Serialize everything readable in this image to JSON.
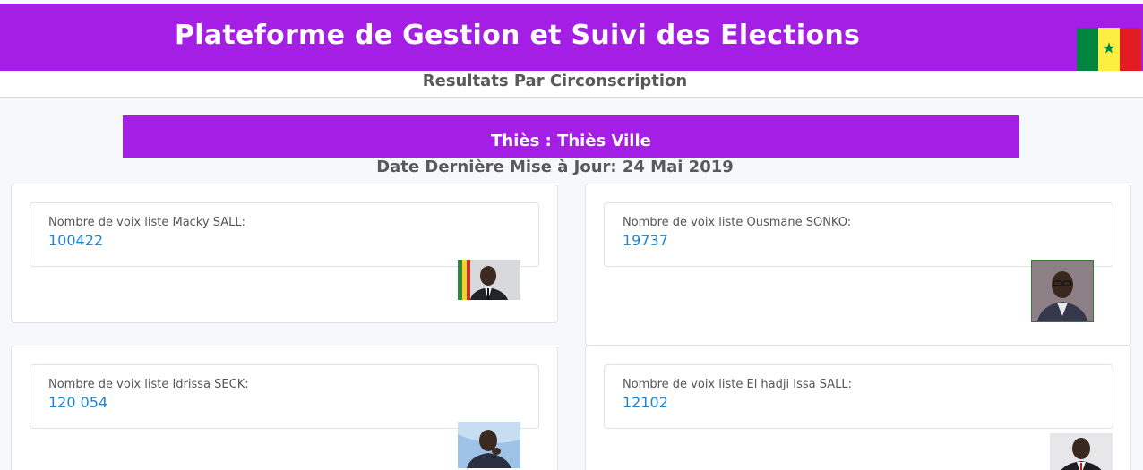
{
  "header": {
    "app_title": "Plateforme de Gestion et Suivi des Elections",
    "flag": {
      "icon": "senegal-flag-icon",
      "colors": [
        "#00853f",
        "#fdef42",
        "#e31b23"
      ],
      "star": "★"
    }
  },
  "subheader": {
    "title": "Resultats Par Circonscription"
  },
  "region": {
    "label": "Thiès : Thiès Ville",
    "last_update": "Date Dernière Mise à Jour: 24 Mai 2019"
  },
  "colors": {
    "accent": "#a51ee6",
    "value": "#1a86d8"
  },
  "results": [
    {
      "label": "Nombre de voix liste Macky SALL:",
      "votes": "100422",
      "photo_icon": "candidate-photo-macky-sall"
    },
    {
      "label": "Nombre de voix liste Ousmane SONKO:",
      "votes": "19737",
      "photo_icon": "candidate-photo-ousmane-sonko"
    },
    {
      "label": "Nombre de voix liste Idrissa SECK:",
      "votes": "120 054",
      "photo_icon": "candidate-photo-idrissa-seck"
    },
    {
      "label": "Nombre de voix liste El hadji Issa SALL:",
      "votes": "12102",
      "photo_icon": "candidate-photo-issa-sall"
    }
  ]
}
